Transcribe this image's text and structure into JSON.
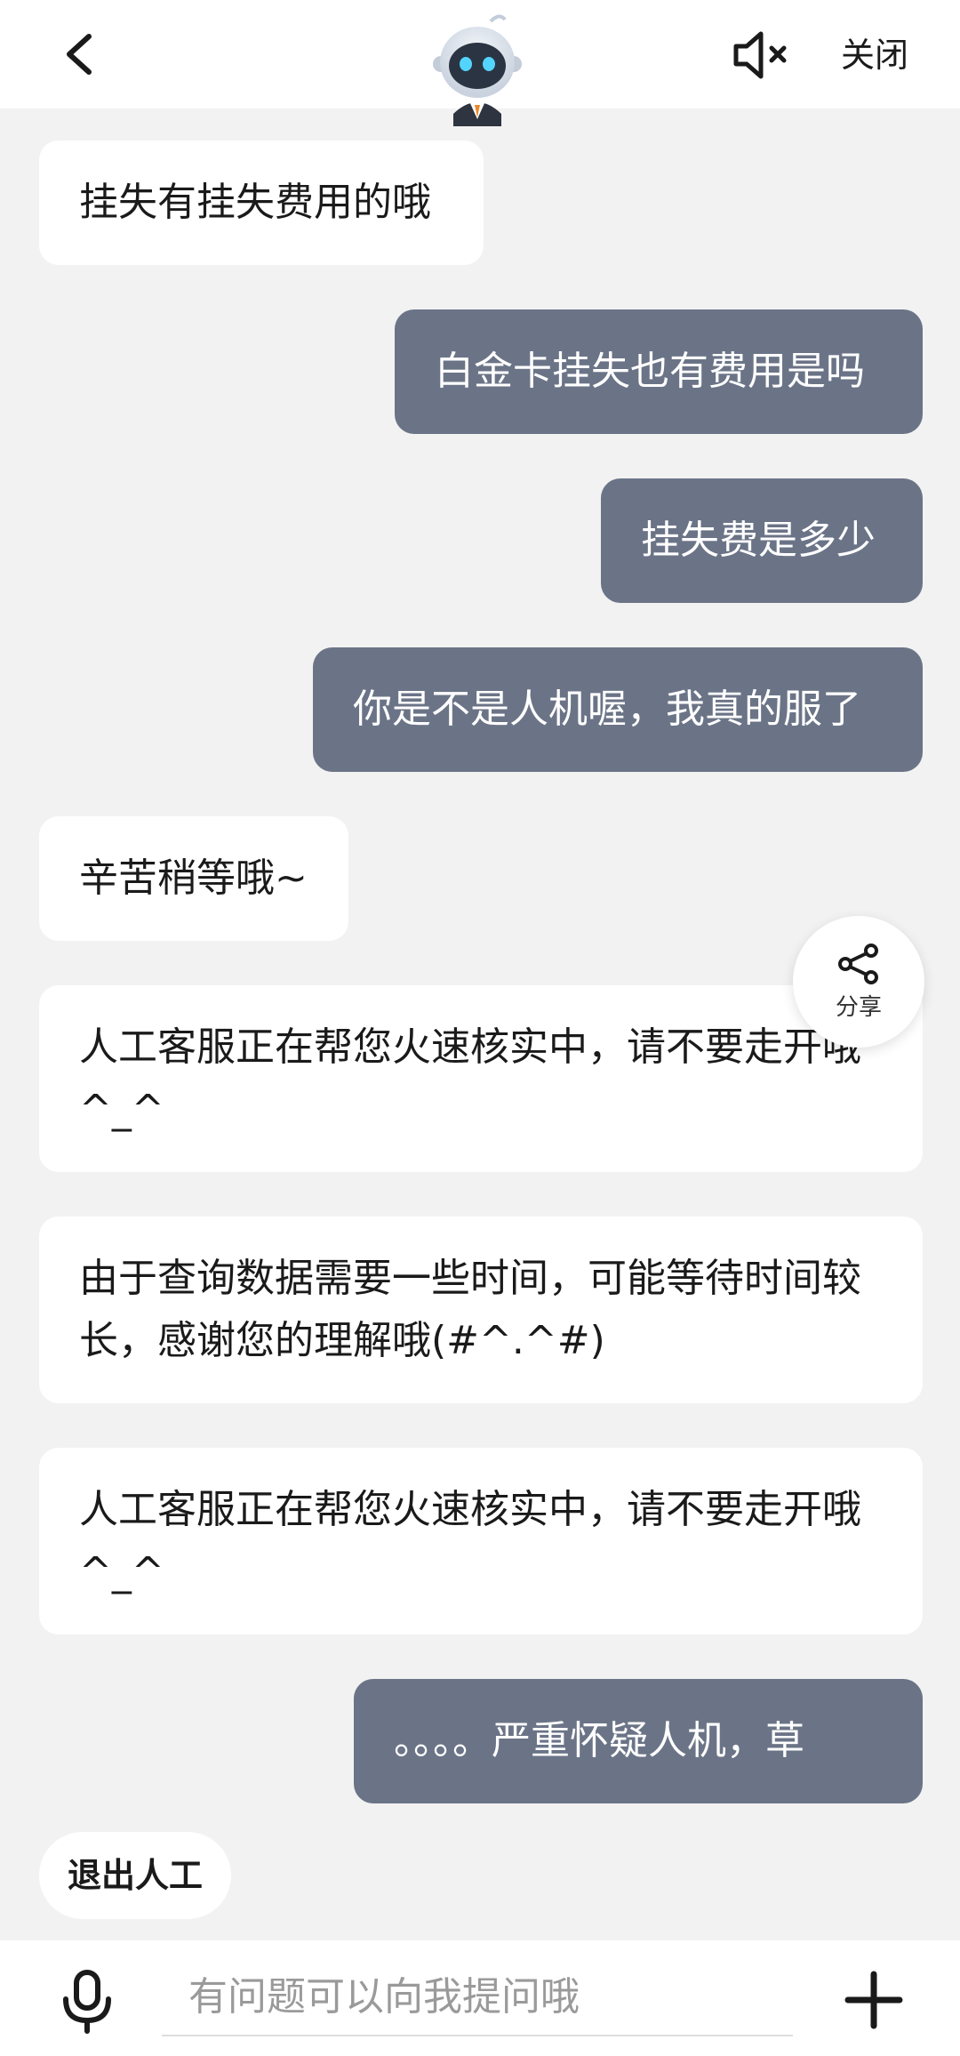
{
  "header": {
    "close_label": "关闭"
  },
  "messages": [
    {
      "role": "bot",
      "text": "挂失有挂失费用的哦"
    },
    {
      "role": "user",
      "text": "白金卡挂失也有费用是吗"
    },
    {
      "role": "user",
      "text": "挂失费是多少"
    },
    {
      "role": "user",
      "text": "你是不是人机喔，我真的服了"
    },
    {
      "role": "bot",
      "text": "辛苦稍等哦~"
    },
    {
      "role": "bot",
      "text": "人工客服正在帮您火速核实中，请不要走开哦^_^"
    },
    {
      "role": "bot",
      "text": "由于查询数据需要一些时间，可能等待时间较长，感谢您的理解哦(#^.^#)"
    },
    {
      "role": "bot",
      "text": "人工客服正在帮您火速核实中，请不要走开哦^_^"
    },
    {
      "role": "user",
      "text": "。。。。严重怀疑人机，草"
    }
  ],
  "share": {
    "label": "分享"
  },
  "exit_button": {
    "label": "退出人工"
  },
  "input": {
    "placeholder": "有问题可以向我提问哦",
    "value": ""
  },
  "colors": {
    "user_bubble": "#6b7487",
    "bot_bubble": "#ffffff",
    "background": "#f2f2f2"
  },
  "icons": [
    "back-arrow-icon",
    "robot-avatar-icon",
    "mute-icon",
    "share-icon",
    "microphone-icon",
    "plus-icon"
  ]
}
